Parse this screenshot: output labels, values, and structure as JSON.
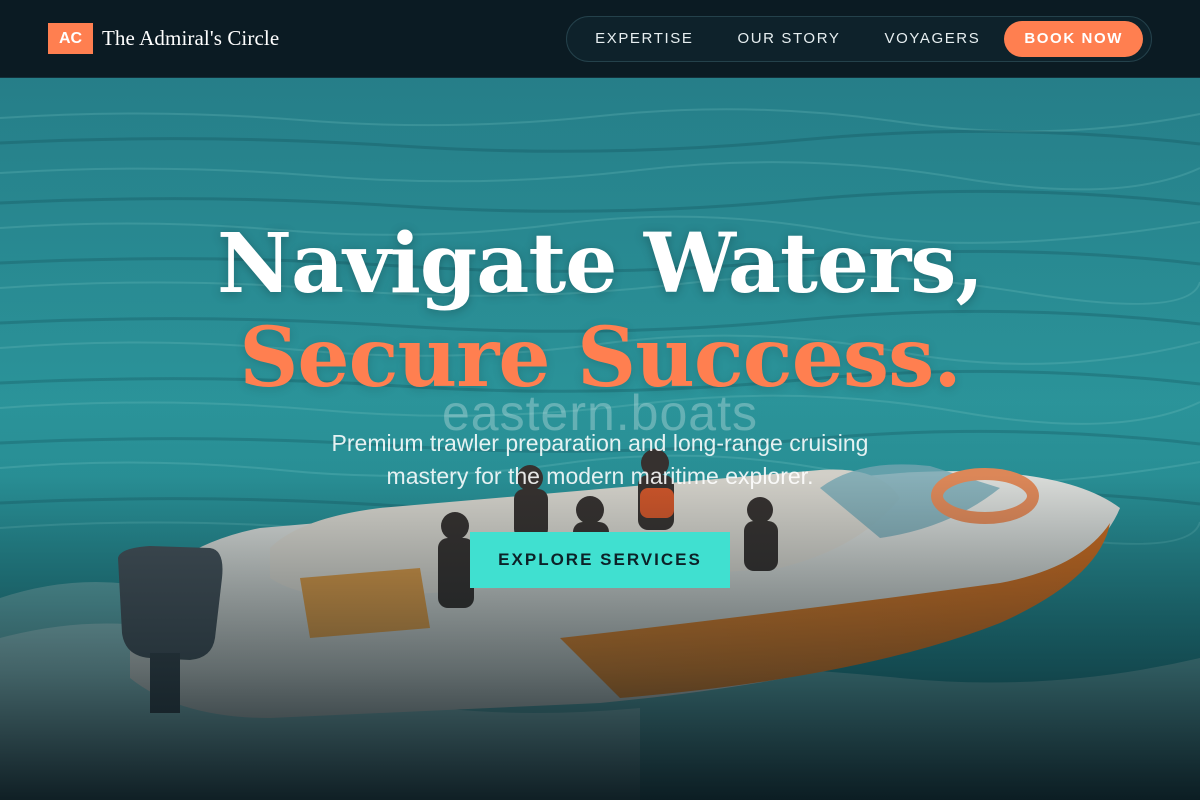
{
  "header": {
    "logo_text": "AC",
    "brand_name": "The Admiral's Circle",
    "nav": [
      {
        "label": "EXPERTISE"
      },
      {
        "label": "OUR STORY"
      },
      {
        "label": "VOYAGERS"
      }
    ],
    "book_label": "BOOK NOW"
  },
  "hero": {
    "headline_line1": "Navigate Waters,",
    "headline_line2": "Secure Success.",
    "watermark": "eastern.boats",
    "subtitle": "Premium trawler preparation and long-range cruising mastery for the modern maritime explorer.",
    "cta_label": "EXPLORE SERVICES",
    "background_image": "speedboat-photo"
  },
  "colors": {
    "accent": "#ff7f50",
    "cta": "#40e0d0",
    "header_bg": "#0b1b23",
    "sea": "#2a9fa5"
  }
}
